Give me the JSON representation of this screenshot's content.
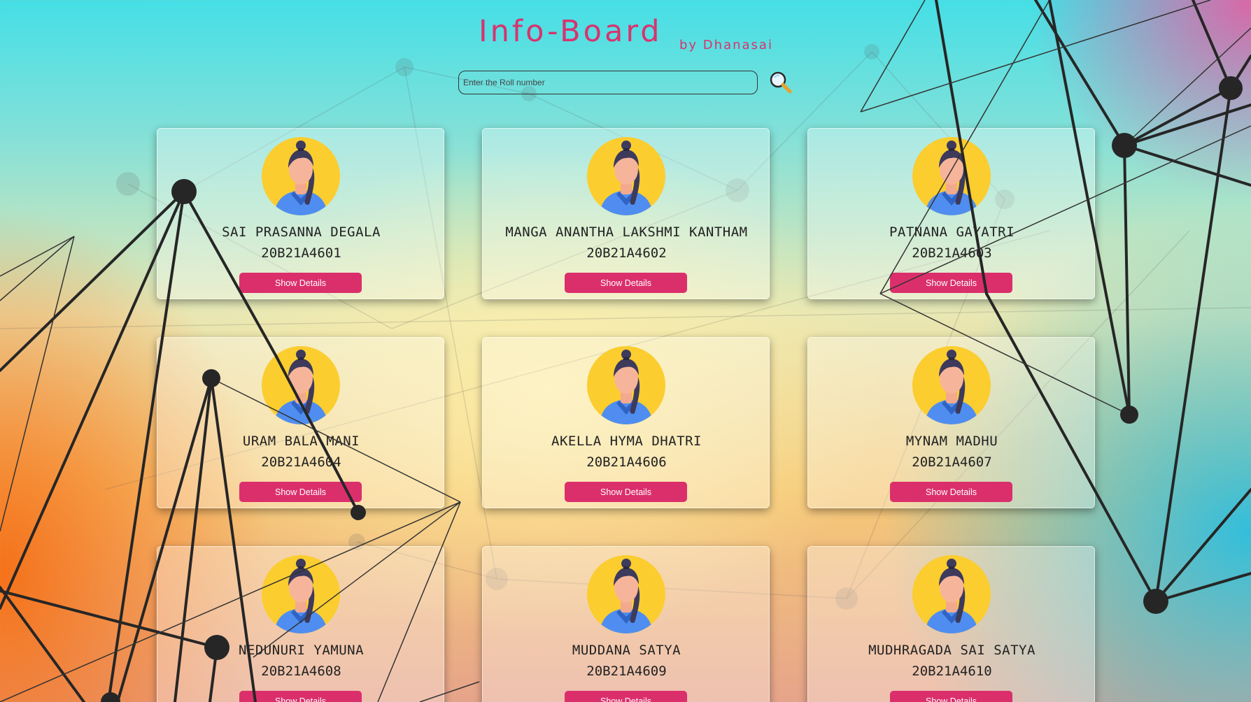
{
  "header": {
    "title": "Info-Board",
    "byline": "by Dhanasai"
  },
  "search": {
    "placeholder": "Enter the Roll number",
    "value": ""
  },
  "icons": {
    "search": "search-magnifier-icon",
    "avatar": "student-avatar-icon"
  },
  "colors": {
    "accent": "#db2f6c",
    "title": "#d8336e",
    "avatar_bg": "#fbcd2f",
    "avatar_shirt": "#4f8ef0"
  },
  "cards": [
    {
      "name": "SAI PRASANNA DEGALA",
      "roll": "20B21A4601",
      "button": "Show Details"
    },
    {
      "name": "MANGA ANANTHA LAKSHMI KANTHAM",
      "roll": "20B21A4602",
      "button": "Show Details"
    },
    {
      "name": "PATNANA GAYATRI",
      "roll": "20B21A4603",
      "button": "Show Details"
    },
    {
      "name": "URAM BALA MANI",
      "roll": "20B21A4604",
      "button": "Show Details"
    },
    {
      "name": "AKELLA HYMA DHATRI",
      "roll": "20B21A4606",
      "button": "Show Details"
    },
    {
      "name": "MYNAM MADHU",
      "roll": "20B21A4607",
      "button": "Show Details"
    },
    {
      "name": "NEDUNURI YAMUNA",
      "roll": "20B21A4608",
      "button": "Show Details"
    },
    {
      "name": "MUDDANA SATYA",
      "roll": "20B21A4609",
      "button": "Show Details"
    },
    {
      "name": "MUDHRAGADA SAI SATYA",
      "roll": "20B21A4610",
      "button": "Show Details"
    }
  ]
}
